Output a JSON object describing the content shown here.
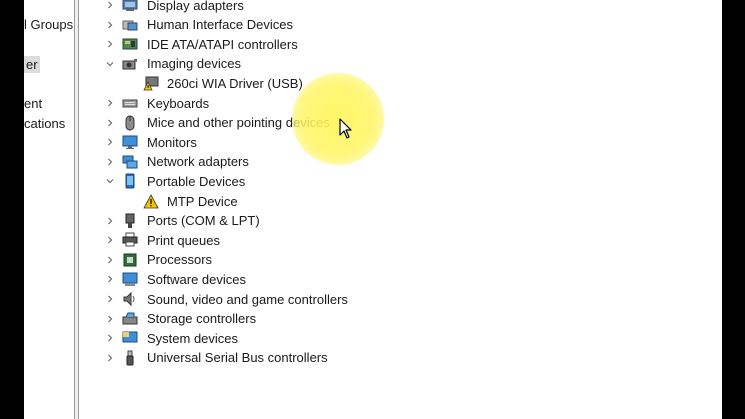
{
  "left_pane": {
    "items": [
      {
        "label": "l Groups"
      },
      {
        "label": "er",
        "selected": true
      },
      {
        "label": "ent"
      },
      {
        "label": "cations"
      }
    ]
  },
  "tree": {
    "nodes": [
      {
        "label": "Display adapters",
        "icon": "display-adapter-icon",
        "state": "collapsed",
        "level": 0
      },
      {
        "label": "Human Interface Devices",
        "icon": "hid-icon",
        "state": "collapsed",
        "level": 0
      },
      {
        "label": "IDE ATA/ATAPI controllers",
        "icon": "ide-controller-icon",
        "state": "collapsed",
        "level": 0
      },
      {
        "label": "Imaging devices",
        "icon": "camera-icon",
        "state": "expanded",
        "level": 0
      },
      {
        "label": "260ci WIA Driver (USB)",
        "icon": "warning-scanner-icon",
        "state": "leaf",
        "level": 1
      },
      {
        "label": "Keyboards",
        "icon": "keyboard-icon",
        "state": "collapsed",
        "level": 0
      },
      {
        "label": "Mice and other pointing devices",
        "icon": "mouse-icon",
        "state": "collapsed",
        "level": 0
      },
      {
        "label": "Monitors",
        "icon": "monitor-icon",
        "state": "collapsed",
        "level": 0
      },
      {
        "label": "Network adapters",
        "icon": "network-icon",
        "state": "collapsed",
        "level": 0
      },
      {
        "label": "Portable Devices",
        "icon": "portable-device-icon",
        "state": "expanded",
        "level": 0
      },
      {
        "label": "MTP Device",
        "icon": "warning-device-icon",
        "state": "leaf",
        "level": 1
      },
      {
        "label": "Ports (COM & LPT)",
        "icon": "port-icon",
        "state": "collapsed",
        "level": 0
      },
      {
        "label": "Print queues",
        "icon": "printer-icon",
        "state": "collapsed",
        "level": 0
      },
      {
        "label": "Processors",
        "icon": "processor-icon",
        "state": "collapsed",
        "level": 0
      },
      {
        "label": "Software devices",
        "icon": "software-device-icon",
        "state": "collapsed",
        "level": 0
      },
      {
        "label": "Sound, video and game controllers",
        "icon": "speaker-icon",
        "state": "collapsed",
        "level": 0
      },
      {
        "label": "Storage controllers",
        "icon": "storage-icon",
        "state": "collapsed",
        "level": 0
      },
      {
        "label": "System devices",
        "icon": "system-device-icon",
        "state": "collapsed",
        "level": 0
      },
      {
        "label": "Universal Serial Bus controllers",
        "icon": "usb-icon",
        "state": "collapsed",
        "level": 0
      }
    ]
  },
  "colors": {
    "highlight": "#fff45a",
    "warning": "#f5c400",
    "text": "#1a1a1a"
  }
}
